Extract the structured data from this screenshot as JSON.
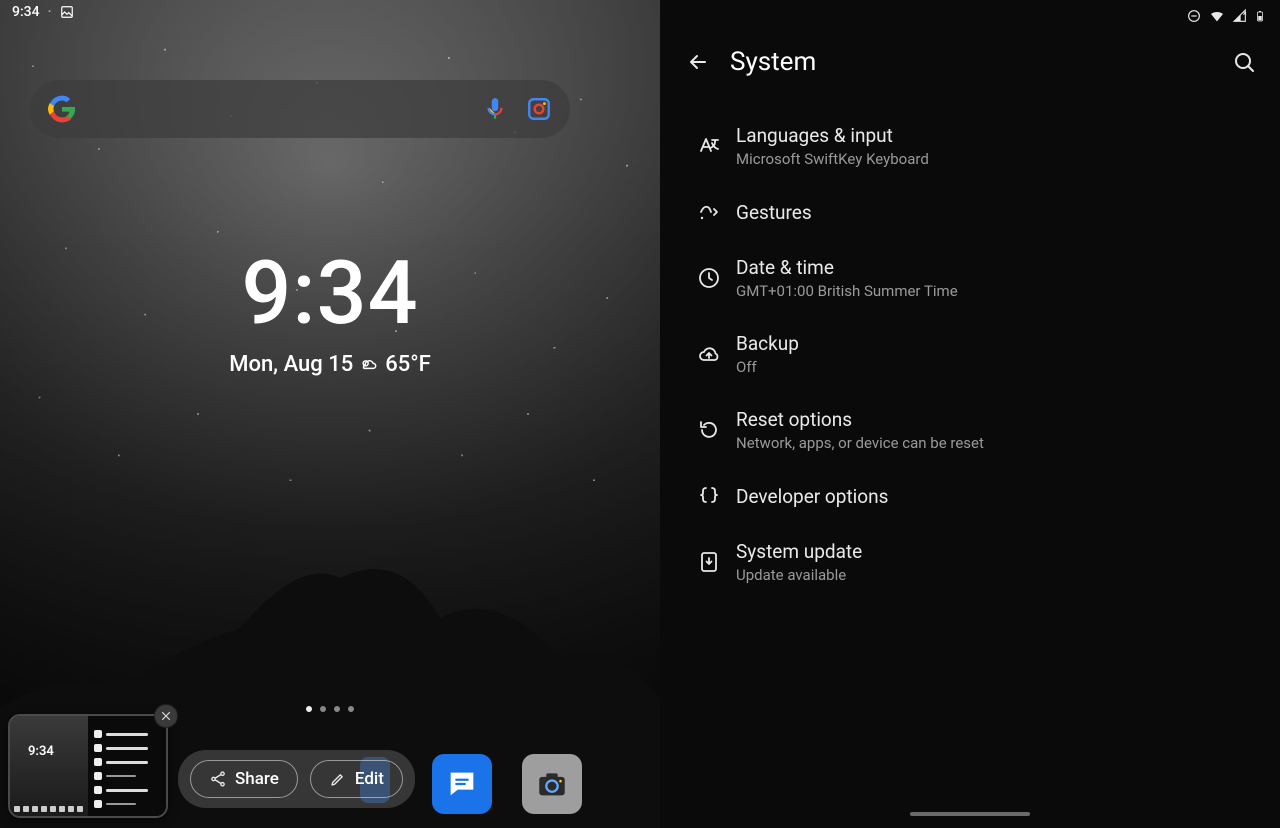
{
  "status_bar": {
    "time": "9:34"
  },
  "home": {
    "clock_time": "9:34",
    "date_line_pre": "Mon, Aug 15",
    "temp": "65°F",
    "thumb_time": "9:34",
    "share_label": "Share",
    "edit_label": "Edit"
  },
  "settings": {
    "title": "System",
    "items": [
      {
        "title": "Languages & input",
        "subtitle": "Microsoft SwiftKey Keyboard"
      },
      {
        "title": "Gestures",
        "subtitle": ""
      },
      {
        "title": "Date & time",
        "subtitle": "GMT+01:00 British Summer Time"
      },
      {
        "title": "Backup",
        "subtitle": "Off"
      },
      {
        "title": "Reset options",
        "subtitle": "Network, apps, or device can be reset"
      },
      {
        "title": "Developer options",
        "subtitle": ""
      },
      {
        "title": "System update",
        "subtitle": "Update available"
      }
    ]
  }
}
